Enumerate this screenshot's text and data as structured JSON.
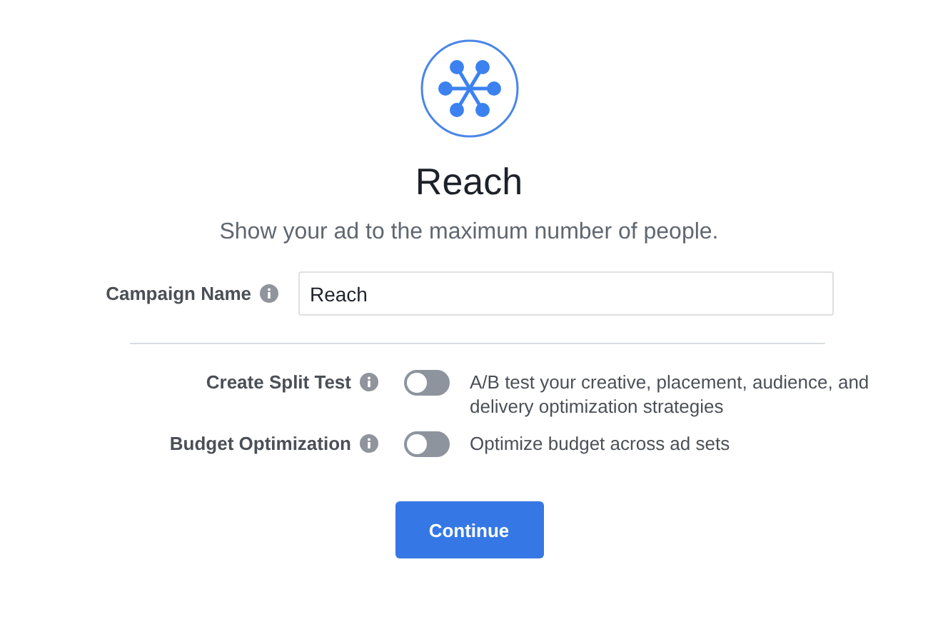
{
  "objective": {
    "title": "Reach",
    "subtitle": "Show your ad to the maximum number of people."
  },
  "campaign_name": {
    "label": "Campaign Name",
    "value": "Reach"
  },
  "options": [
    {
      "label": "Create Split Test",
      "on": false,
      "description": "A/B test your creative, placement, audience, and delivery optimization strategies"
    },
    {
      "label": "Budget Optimization",
      "on": false,
      "description": "Optimize budget across ad sets"
    }
  ],
  "button": "Continue"
}
